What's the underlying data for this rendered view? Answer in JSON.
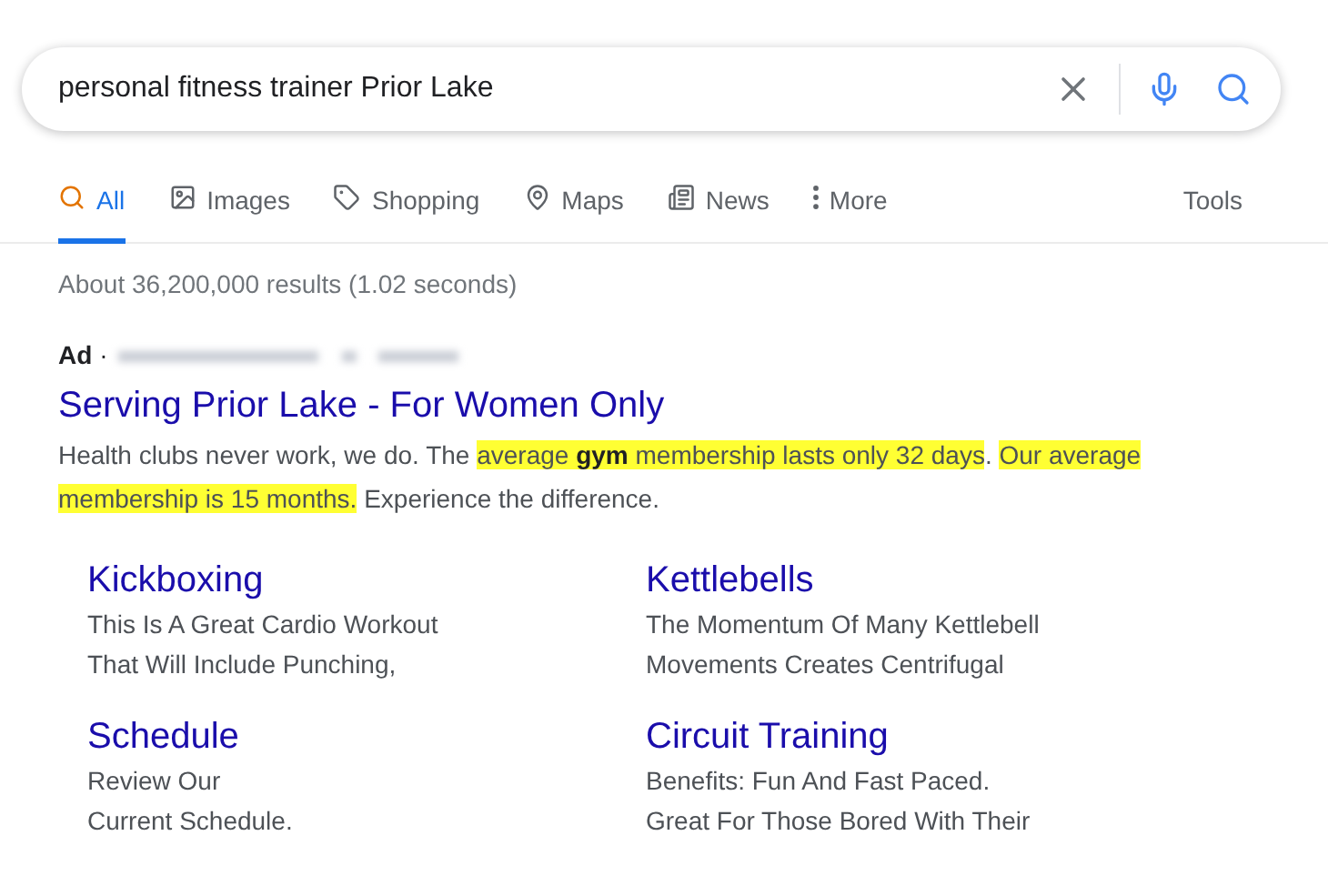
{
  "search": {
    "value": "personal fitness trainer Prior Lake"
  },
  "tabs": [
    {
      "label": "All",
      "selected": true
    },
    {
      "label": "Images",
      "selected": false
    },
    {
      "label": "Shopping",
      "selected": false
    },
    {
      "label": "Maps",
      "selected": false
    },
    {
      "label": "News",
      "selected": false
    },
    {
      "label": "More",
      "selected": false
    }
  ],
  "tools": "Tools",
  "result_stats": "About 36,200,000 results (1.02 seconds)",
  "ad": {
    "badge": "Ad",
    "separator": "·",
    "title": "Serving Prior Lake - For Women Only",
    "description": [
      {
        "text": "Health clubs never work, we do. The ",
        "highlighted": false
      },
      {
        "text": "average **gym** membership lasts only 32 days",
        "highlighted": true
      },
      {
        "text": ". ",
        "highlighted": false
      },
      {
        "text": "Our average membership is 15 months.",
        "highlighted": true
      },
      {
        "text": " Experience the difference.",
        "highlighted": false
      }
    ],
    "sitelinks": [
      {
        "title": "Kickboxing",
        "lines": [
          "This Is A Great Cardio Workout",
          "That Will Include Punching,"
        ]
      },
      {
        "title": "Kettlebells",
        "lines": [
          "The Momentum Of Many Kettlebell",
          "Movements Creates Centrifugal"
        ]
      },
      {
        "title": "Schedule",
        "lines": [
          "Review Our",
          "Current Schedule."
        ]
      },
      {
        "title": "Circuit Training",
        "lines": [
          "Benefits: Fun And Fast Paced.",
          "Great For Those Bored With Their"
        ]
      }
    ]
  }
}
